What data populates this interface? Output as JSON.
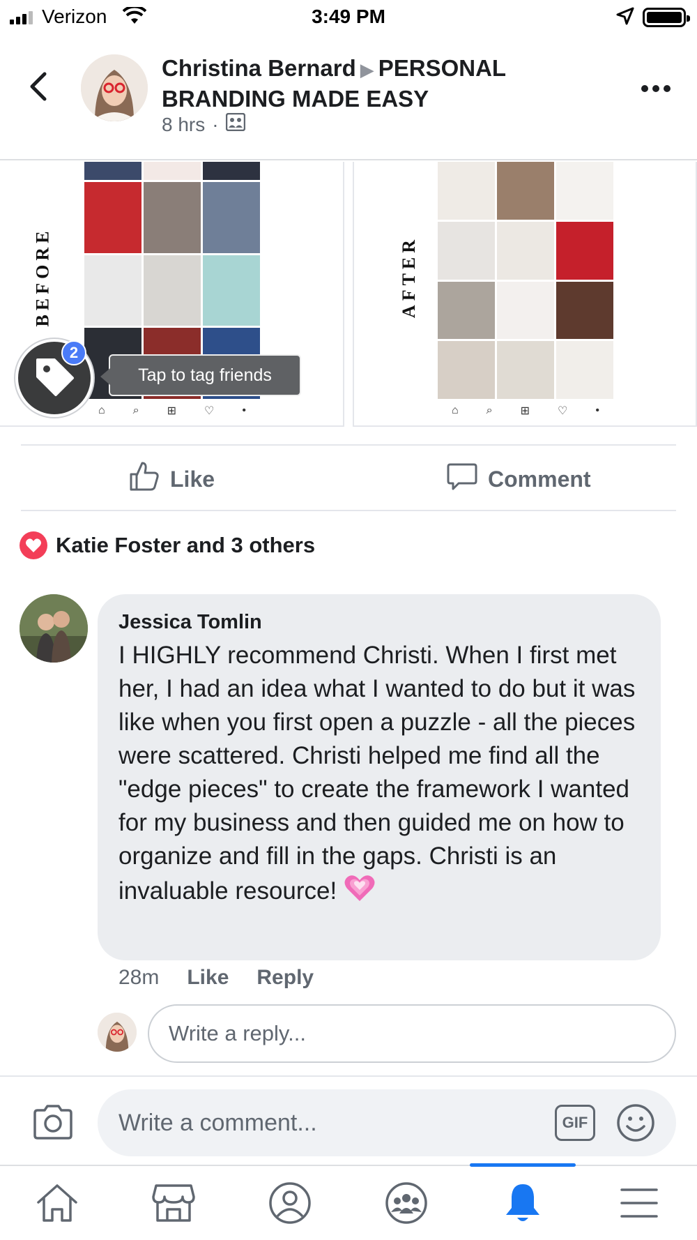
{
  "status_bar": {
    "carrier": "Verizon",
    "time": "3:49 PM"
  },
  "post": {
    "author": "Christina Bernard",
    "group": "PERSONAL BRANDING MADE EASY",
    "time": "8 hrs",
    "audience_icon": "group-audience-icon",
    "photos": {
      "before_label": "BEFORE",
      "after_label": "AFTER"
    },
    "tag_count": "2",
    "tag_tooltip": "Tap to tag friends",
    "like_label": "Like",
    "comment_label": "Comment",
    "reactions_text": "Katie Foster and 3 others"
  },
  "comment": {
    "author": "Jessica Tomlin",
    "text": "I HIGHLY recommend Christi. When I first met her, I had an idea what I wanted to do but it was like when you first open a puzzle - all the pieces were scattered. Christi helped me find all the \"edge pieces\" to create the framework I wanted for my business and then guided me on how to organize and  fill in the gaps. Christi is an invaluable resource!",
    "emoji": "growing-heart-emoji",
    "time": "28m",
    "like_label": "Like",
    "reply_label": "Reply",
    "reply_placeholder": "Write a reply..."
  },
  "composer": {
    "placeholder": "Write a comment...",
    "gif_label": "GIF"
  },
  "tab_bar": {
    "tabs": [
      "home-icon",
      "marketplace-icon",
      "profile-icon",
      "groups-icon",
      "notifications-icon",
      "menu-icon"
    ],
    "active": "notifications-icon"
  },
  "colors": {
    "accent": "#1877f2",
    "love": "#f33e58",
    "badge": "#4a7bf7"
  }
}
